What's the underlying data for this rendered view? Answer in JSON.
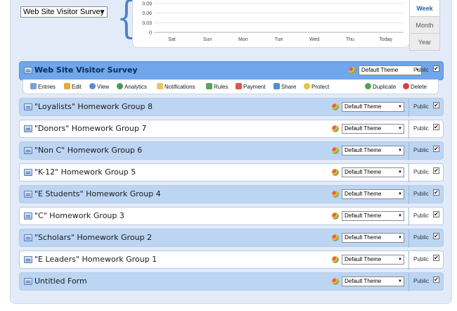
{
  "header": {
    "form_select_value": "Web Site Visitor Survey"
  },
  "chart_data": {
    "type": "line",
    "categories": [
      "Sat",
      "Sun",
      "Mon",
      "Tue",
      "Wed",
      "Thu",
      "Today"
    ],
    "y_ticks": [
      "0.09",
      "0.06",
      "0.03",
      "0"
    ],
    "ylim": [
      0,
      0.09
    ],
    "series": [],
    "grid": true
  },
  "range_tabs": [
    "Week",
    "Month",
    "Year"
  ],
  "selected_form": {
    "title": "Web Site Visitor Survey",
    "theme": "Default Theme",
    "public_label": "Public",
    "public_checked": "✔"
  },
  "toolbar": {
    "entries": "Entries",
    "edit": "Edit",
    "view": "View",
    "analytics": "Analytics",
    "notifications": "Notifications",
    "rules": "Rules",
    "payment": "Payment",
    "share": "Share",
    "protect": "Protect",
    "duplicate": "Duplicate",
    "delete": "Delete"
  },
  "forms": [
    {
      "title": "\"Loyalists\" Homework Group 8",
      "theme": "Default Theme",
      "public_label": "Public",
      "check": "✔"
    },
    {
      "title": "\"Donors\" Homework Group 7",
      "theme": "Default Theme",
      "public_label": "Public",
      "check": "✔"
    },
    {
      "title": "\"Non C\" Homework Group 6",
      "theme": "Default Theme",
      "public_label": "Public",
      "check": "✔"
    },
    {
      "title": "\"K-12\" Homework Group 5",
      "theme": "Default Theme",
      "public_label": "Public",
      "check": "✔"
    },
    {
      "title": "\"E Students\" Homework Group 4",
      "theme": "Default Theme",
      "public_label": "Public",
      "check": "✔"
    },
    {
      "title": "\"C\" Homework Group 3",
      "theme": "Default Theme",
      "public_label": "Public",
      "check": "✔"
    },
    {
      "title": "\"Scholars\" Homework Group 2",
      "theme": "Default Theme",
      "public_label": "Public",
      "check": "✔"
    },
    {
      "title": "\"E Leaders\" Homework Group 1",
      "theme": "Default Theme",
      "public_label": "Public",
      "check": "✔"
    },
    {
      "title": "Untitled Form",
      "theme": "Default Theme",
      "public_label": "Public",
      "check": "✔"
    }
  ]
}
